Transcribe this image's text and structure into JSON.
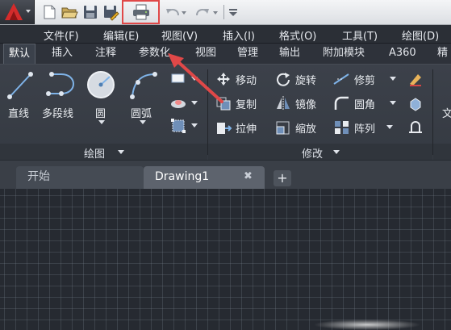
{
  "app": {
    "name": "AutoCAD"
  },
  "quick_access": {
    "items": [
      "new-icon",
      "open-icon",
      "save-icon",
      "save-as-icon",
      "plot-icon",
      "undo-icon",
      "redo-icon",
      "customize-icon"
    ],
    "highlighted": "plot-icon",
    "highlight_color": "#e04848"
  },
  "menubar": {
    "items": [
      "文件(F)",
      "编辑(E)",
      "视图(V)",
      "插入(I)",
      "格式(O)",
      "工具(T)",
      "绘图(D)"
    ]
  },
  "ribbon_tabs": {
    "items": [
      "默认",
      "插入",
      "注释",
      "参数化",
      "视图",
      "管理",
      "输出",
      "附加模块",
      "A360",
      "精"
    ],
    "active": "默认"
  },
  "draw_panel": {
    "title": "绘图",
    "line": "直线",
    "polyline": "多段线",
    "circle": "圆",
    "arc": "圆弧"
  },
  "modify_panel": {
    "title": "修改",
    "move": "移动",
    "rotate": "旋转",
    "trim": "修剪",
    "copy": "复制",
    "mirror": "镜像",
    "fillet": "圆角",
    "stretch": "拉伸",
    "scale": "缩放",
    "array": "阵列"
  },
  "extra_label": "文",
  "file_tabs": {
    "start": "开始",
    "drawing": "Drawing1",
    "close_glyph": "✖",
    "add_glyph": "+"
  },
  "annotation": {
    "arrow_color": "#e04848"
  }
}
